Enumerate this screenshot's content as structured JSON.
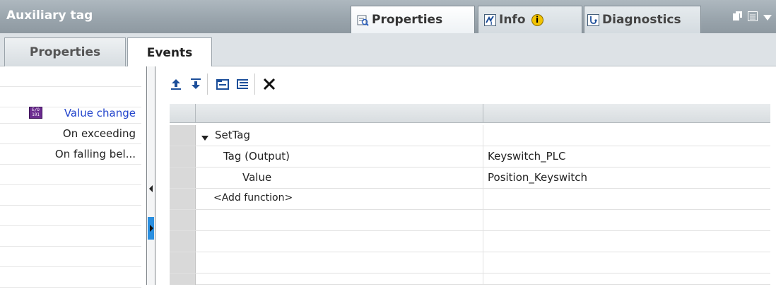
{
  "window": {
    "title": "Auxiliary tag",
    "tabs": [
      {
        "label": "Properties",
        "icon": "properties-icon",
        "active": true
      },
      {
        "label": "Info",
        "icon": "info-icon",
        "active": false
      },
      {
        "label": "Diagnostics",
        "icon": "diagnostics-icon",
        "active": false
      }
    ],
    "info_badge": "i"
  },
  "subtabs": [
    {
      "label": "Properties",
      "active": false
    },
    {
      "label": "Events",
      "active": true
    }
  ],
  "events": [
    {
      "label": "Value change",
      "selected": true,
      "icon": "event-icon"
    },
    {
      "label": "On exceeding",
      "selected": false
    },
    {
      "label": "On falling bel...",
      "selected": false
    }
  ],
  "toolbar": [
    {
      "name": "move-up-icon"
    },
    {
      "name": "move-down-icon"
    },
    {
      "name": "collapse-all-icon"
    },
    {
      "name": "expand-all-icon"
    },
    {
      "name": "delete-icon"
    }
  ],
  "grid": {
    "function_name": "SetTag",
    "params": [
      {
        "name": "Tag (Output)",
        "value": "Keyswitch_PLC"
      },
      {
        "name": "Value",
        "value": "Position_Keyswitch"
      }
    ],
    "add_function": "<Add function>"
  },
  "colors": {
    "title_bar": "#9aa5ad",
    "selected_event": "#2244cc",
    "event_icon": "#6b2b8f",
    "info_badge": "#f2c300"
  }
}
